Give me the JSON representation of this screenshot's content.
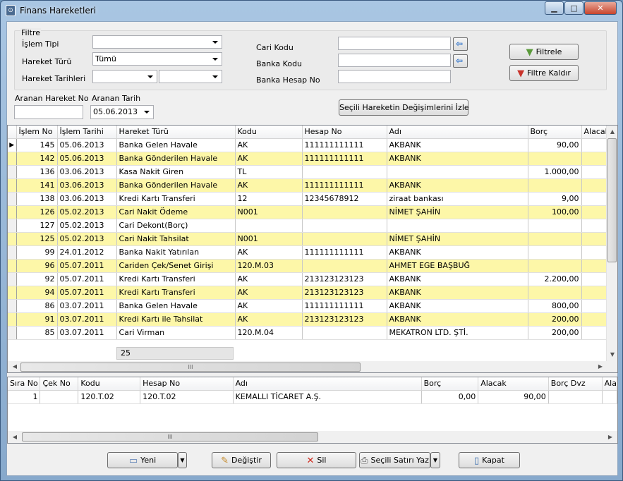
{
  "window": {
    "title": "Finans Hareketleri",
    "min": "▁",
    "max": "□",
    "close": "✕"
  },
  "filter": {
    "group": "Filtre",
    "islem_tipi_label": "İşlem Tipi",
    "islem_tipi_value": "",
    "hareket_turu_label": "Hareket Türü",
    "hareket_turu_value": "Tümü",
    "hareket_tarihleri_label": "Hareket Tarihleri",
    "tarih1": "",
    "tarih2": "",
    "cari_kodu_label": "Cari Kodu",
    "cari_kodu_value": "",
    "banka_kodu_label": "Banka Kodu",
    "banka_kodu_value": "",
    "banka_hesap_label": "Banka Hesap No",
    "banka_hesap_value": "",
    "filtrele": "Filtrele",
    "filtre_kaldir": "Filtre Kaldır",
    "aranan_no_label": "Aranan Hareket No",
    "aranan_no_value": "",
    "aranan_tarih_label": "Aranan Tarih",
    "aranan_tarih_value": "05.06.2013",
    "degisim_button": "Seçili Hareketin Değişimlerini İzle"
  },
  "main_grid": {
    "headers": [
      "İşlem No",
      "İşlem Tarihi",
      "Hareket Türü",
      "Kodu",
      "Hesap No",
      "Adı",
      "Borç",
      "Alacak"
    ],
    "rows": [
      [
        "145",
        "05.06.2013",
        "Banka Gelen Havale",
        "AK",
        "111111111111",
        "AKBANK",
        "90,00",
        ""
      ],
      [
        "142",
        "05.06.2013",
        "Banka Gönderilen Havale",
        "AK",
        "111111111111",
        "AKBANK",
        "",
        ""
      ],
      [
        "136",
        "03.06.2013",
        "Kasa Nakit Giren",
        "TL",
        "",
        "",
        "1.000,00",
        ""
      ],
      [
        "141",
        "03.06.2013",
        "Banka Gönderilen Havale",
        "AK",
        "111111111111",
        "AKBANK",
        "",
        ""
      ],
      [
        "138",
        "03.06.2013",
        "Kredi Kartı Transferi",
        "12",
        "12345678912",
        "ziraat bankası",
        "9,00",
        ""
      ],
      [
        "126",
        "05.02.2013",
        "Cari Nakit Ödeme",
        "N001",
        "",
        "NİMET ŞAHİN",
        "100,00",
        ""
      ],
      [
        "127",
        "05.02.2013",
        "Cari Dekont(Borç)",
        "",
        "",
        "",
        "",
        ""
      ],
      [
        "125",
        "05.02.2013",
        "Cari Nakit Tahsilat",
        "N001",
        "",
        "NİMET ŞAHİN",
        "",
        ""
      ],
      [
        "99",
        "24.01.2012",
        "Banka Nakit Yatırılan",
        "AK",
        "111111111111",
        "AKBANK",
        "",
        ""
      ],
      [
        "96",
        "05.07.2011",
        "Cariden Çek/Senet Girişi",
        "120.M.03",
        "",
        "AHMET EGE BAŞBUĞ",
        "",
        ""
      ],
      [
        "92",
        "05.07.2011",
        "Kredi Kartı Transferi",
        "AK",
        "213123123123",
        "AKBANK",
        "2.200,00",
        ""
      ],
      [
        "94",
        "05.07.2011",
        "Kredi Kartı Transferi",
        "AK",
        "213123123123",
        "AKBANK",
        "",
        ""
      ],
      [
        "86",
        "03.07.2011",
        "Banka Gelen Havale",
        "AK",
        "111111111111",
        "AKBANK",
        "800,00",
        ""
      ],
      [
        "91",
        "03.07.2011",
        "Kredi Kartı ile Tahsilat",
        "AK",
        "213123123123",
        "AKBANK",
        "200,00",
        ""
      ],
      [
        "85",
        "03.07.2011",
        "Cari Virman",
        "120.M.04",
        "",
        "MEKATRON LTD. ŞTİ.",
        "200,00",
        ""
      ]
    ],
    "count": "25",
    "hscroll_grip": "III"
  },
  "detail_grid": {
    "headers": [
      "Sıra No",
      "Çek No",
      "Kodu",
      "Hesap No",
      "Adı",
      "Borç",
      "Alacak",
      "Borç Dvz",
      "Ala"
    ],
    "rows": [
      [
        "1",
        "",
        "120.T.02",
        "120.T.02",
        "KEMALLI TİCARET A.Ş.",
        "0,00",
        "90,00",
        "",
        ""
      ]
    ],
    "hscroll_grip": "III"
  },
  "buttons": {
    "yeni": "Yeni",
    "degistir": "Değiştir",
    "sil": "Sil",
    "yazdir": "Seçili Satırı Yaz",
    "kapat": "Kapat"
  }
}
